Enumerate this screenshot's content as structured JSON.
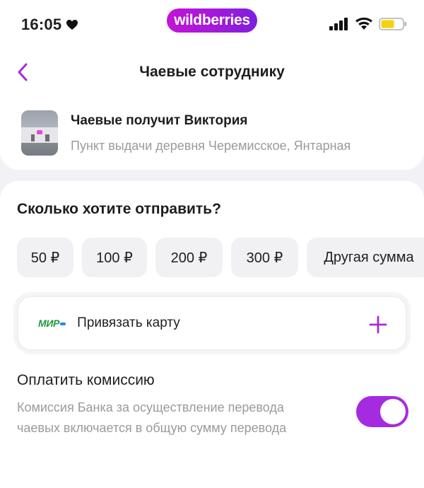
{
  "status_bar": {
    "time": "16:05",
    "brand": "wildberries",
    "icons": [
      "heart-icon",
      "signal-icon",
      "wifi-icon",
      "battery-icon"
    ]
  },
  "header": {
    "title": "Чаевые сотруднику",
    "back_icon": "chevron-left-icon"
  },
  "recipient": {
    "name": "Чаевые получит Виктория",
    "place": "Пункт выдачи деревня Черемисское, Янтарная"
  },
  "tips": {
    "title": "Сколько хотите отправить?",
    "amounts": [
      "50 ₽",
      "100 ₽",
      "200 ₽",
      "300 ₽",
      "Другая сумма"
    ]
  },
  "card": {
    "logo": "МИР",
    "label": "Привязать карту",
    "add_icon": "plus-icon"
  },
  "commission": {
    "title": "Оплатить комиссию",
    "description": "Комиссия Банка за осуществление перевода чаевых включается в общую сумму перевода",
    "enabled": true
  },
  "colors": {
    "accent": "#a52be0",
    "brand_gradient_start": "#c214d6",
    "brand_gradient_end": "#7d1ee0",
    "mir_green": "#1f9b3c",
    "secondary_text": "#9a9aa0"
  }
}
